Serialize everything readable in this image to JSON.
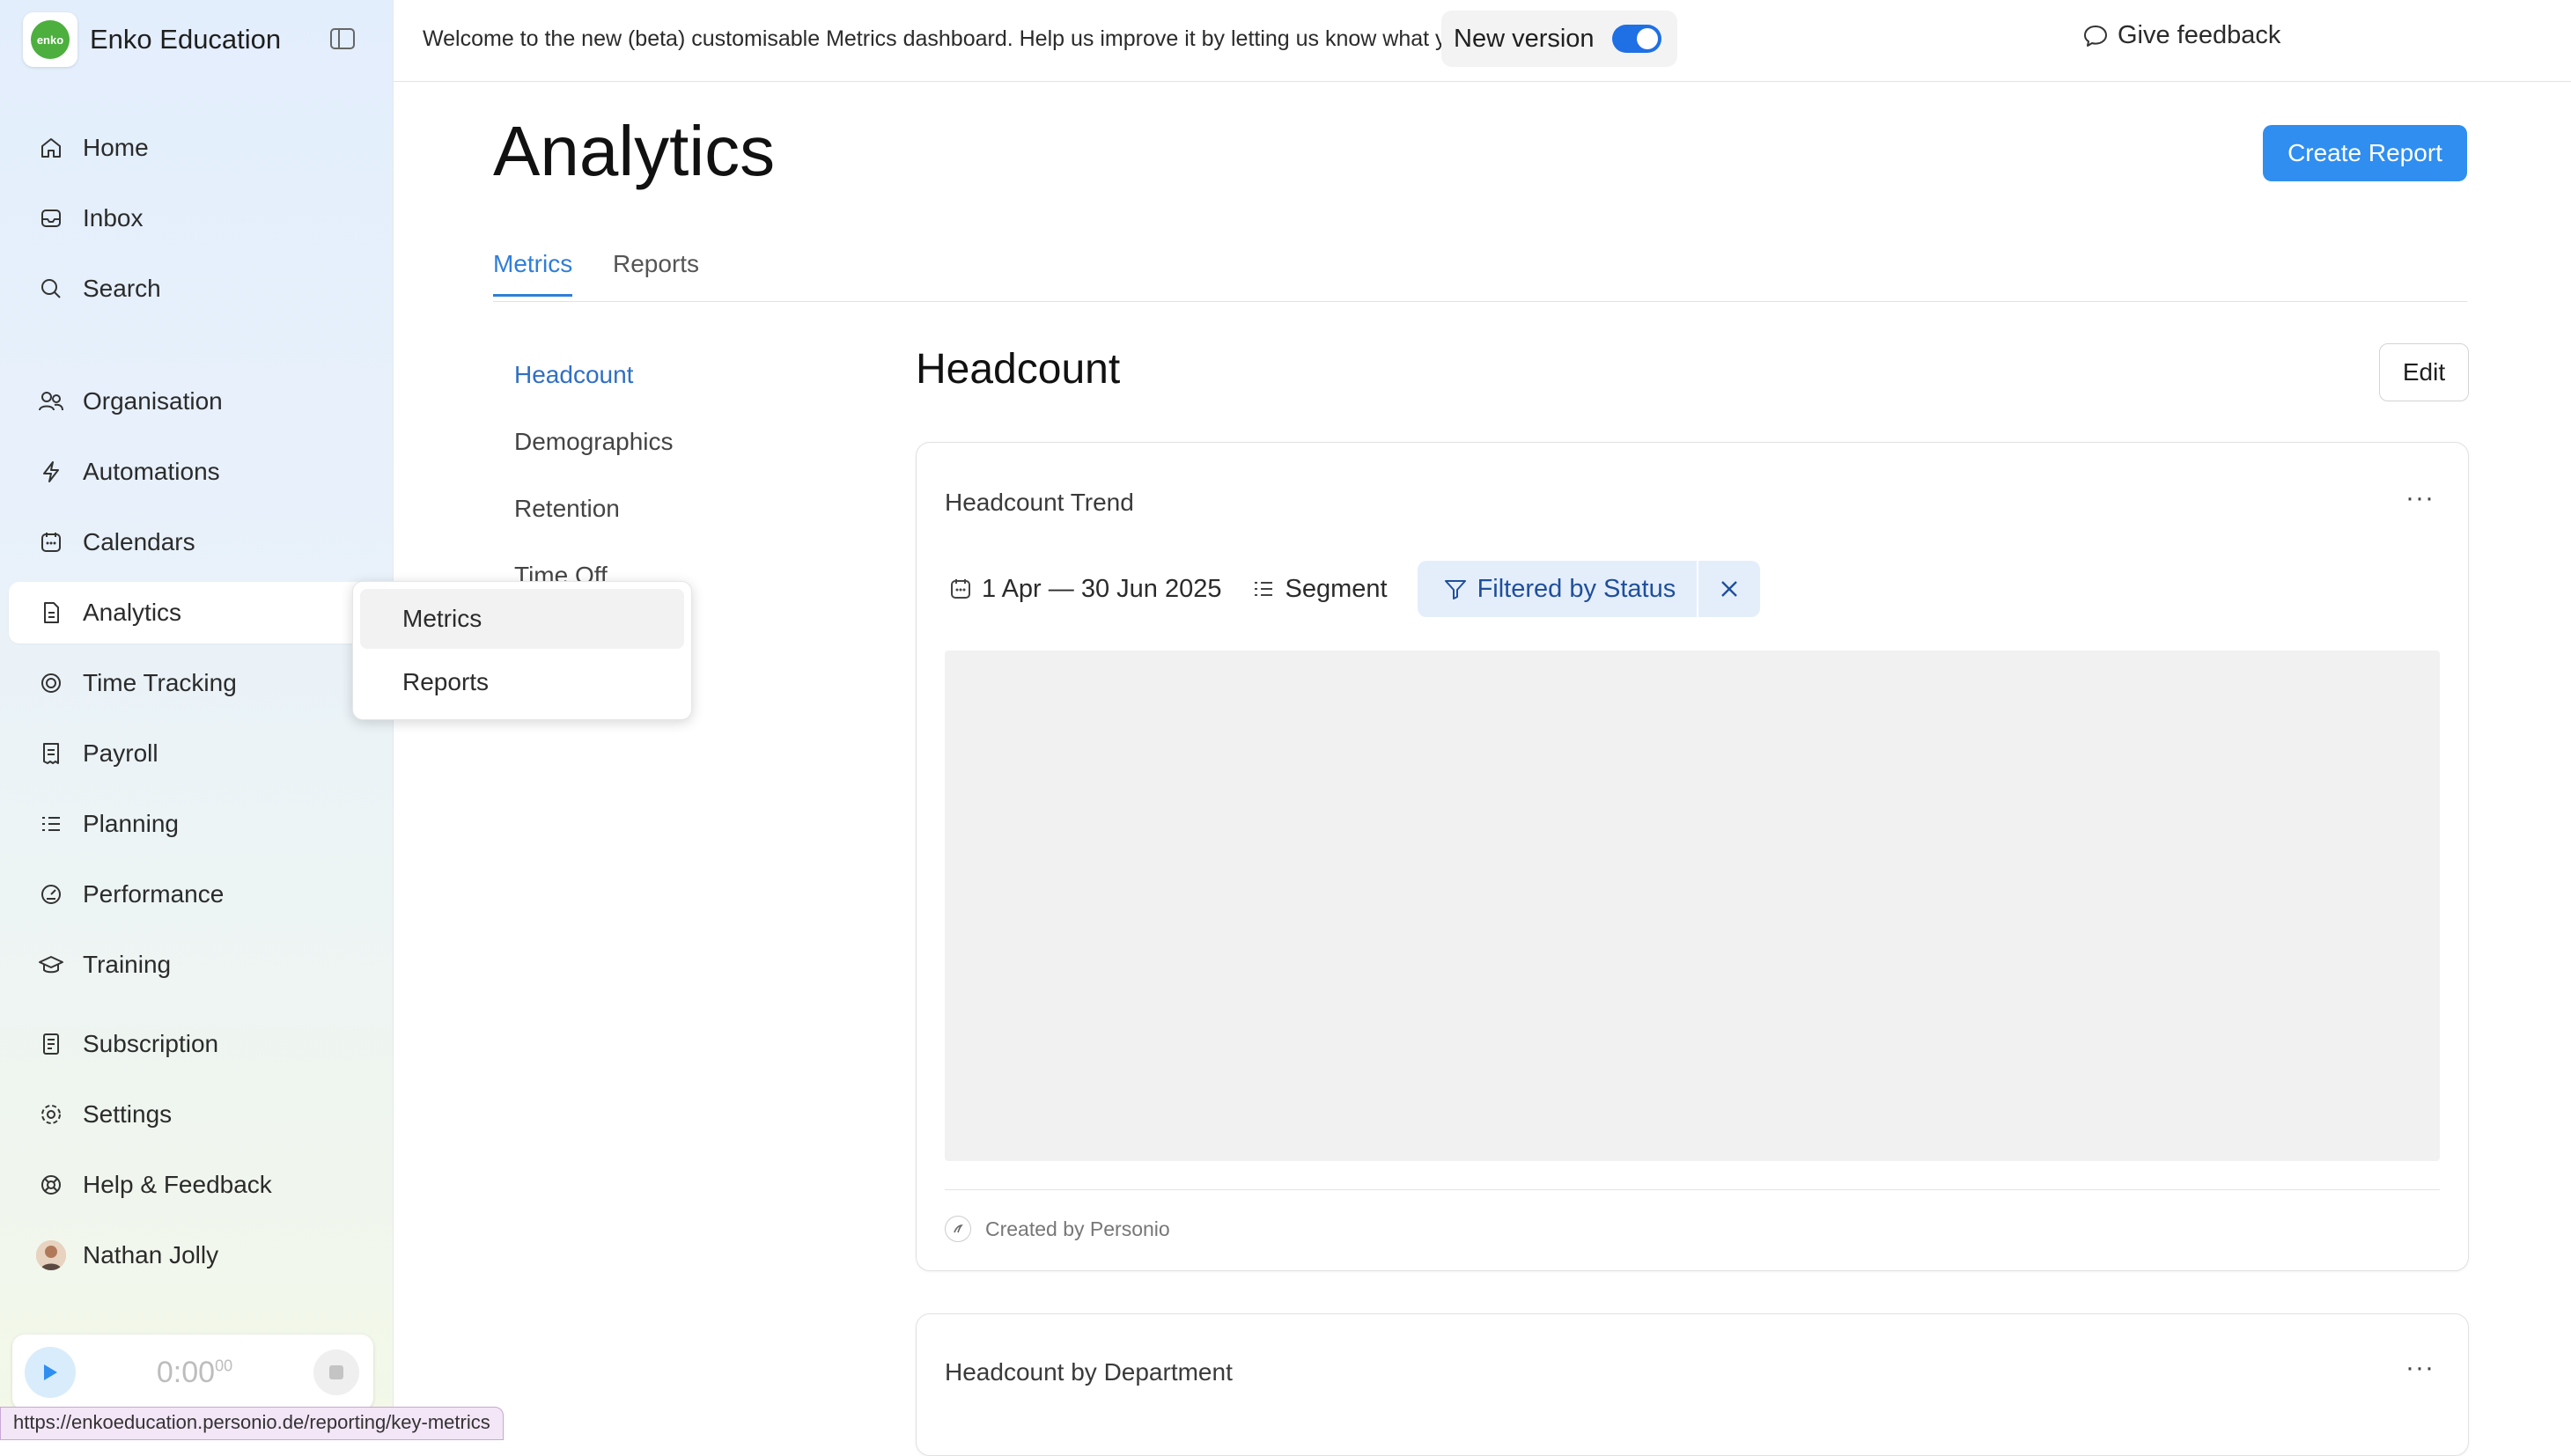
{
  "brand": {
    "name": "Enko Education",
    "logo_text": "enko"
  },
  "sidebar": {
    "items": [
      {
        "label": "Home",
        "icon": "home-icon"
      },
      {
        "label": "Inbox",
        "icon": "inbox-icon"
      },
      {
        "label": "Search",
        "icon": "search-icon"
      },
      {
        "label": "Organisation",
        "icon": "people-icon"
      },
      {
        "label": "Automations",
        "icon": "lightning-icon"
      },
      {
        "label": "Calendars",
        "icon": "calendar-icon"
      },
      {
        "label": "Analytics",
        "icon": "document-icon"
      },
      {
        "label": "Time Tracking",
        "icon": "target-icon"
      },
      {
        "label": "Payroll",
        "icon": "receipt-icon"
      },
      {
        "label": "Planning",
        "icon": "list-icon"
      },
      {
        "label": "Performance",
        "icon": "gauge-icon"
      },
      {
        "label": "Training",
        "icon": "graduation-cap-icon"
      },
      {
        "label": "Subscription",
        "icon": "receipt-icon"
      },
      {
        "label": "Settings",
        "icon": "gear-icon"
      },
      {
        "label": "Help & Feedback",
        "icon": "lifebuoy-icon"
      },
      {
        "label": "Nathan Jolly",
        "icon": "avatar"
      }
    ]
  },
  "timer": {
    "time": "0:00",
    "fraction": "00"
  },
  "status_url": "https://enkoeducation.personio.de/reporting/key-metrics",
  "topbar": {
    "banner": "Welcome to the new (beta) customisable Metrics dashboard. Help us improve it by letting us know what you think!",
    "feedback": "Give feedback",
    "new_version": "New version",
    "new_version_on": true
  },
  "page": {
    "title": "Analytics",
    "create_button": "Create Report"
  },
  "tabs": [
    {
      "label": "Metrics"
    },
    {
      "label": "Reports"
    }
  ],
  "subnav": [
    {
      "label": "Headcount"
    },
    {
      "label": "Demographics"
    },
    {
      "label": "Retention"
    },
    {
      "label": "Time Off"
    }
  ],
  "popover": {
    "items": [
      {
        "label": "Metrics"
      },
      {
        "label": "Reports"
      }
    ]
  },
  "section": {
    "title": "Headcount",
    "edit": "Edit"
  },
  "card1": {
    "title": "Headcount Trend",
    "more": "···",
    "date_range": "1 Apr — 30 Jun 2025",
    "segment": "Segment",
    "filter": "Filtered by Status",
    "created_by": "Created by Personio"
  },
  "card2": {
    "title": "Headcount by Department",
    "more": "···"
  },
  "colors": {
    "accent": "#2f8ef0",
    "active_tab": "#2f7ed8",
    "filter_chip_bg": "#e4eefb",
    "toggle_on": "#1f6fe5"
  }
}
